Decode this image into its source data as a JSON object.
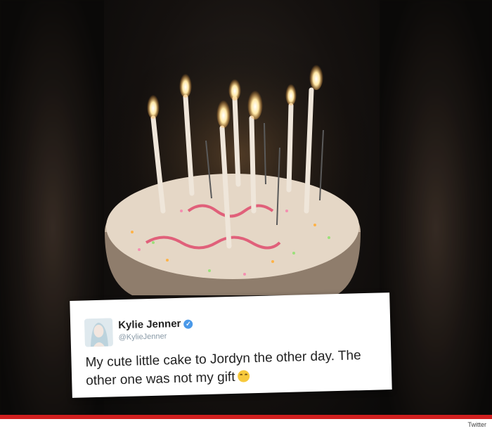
{
  "photo": {
    "description_icon": "birthday-cake-photo"
  },
  "tweet": {
    "user_name": "Kylie Jenner",
    "handle": "@KylieJenner",
    "text": "My cute little cake to Jordyn the other day. The other one was not my gift",
    "emoji": "smiling-face-icon",
    "verified_color": "#4a99e9"
  },
  "footer": {
    "credit": "Twitter",
    "bar_color": "#d11f1f"
  }
}
